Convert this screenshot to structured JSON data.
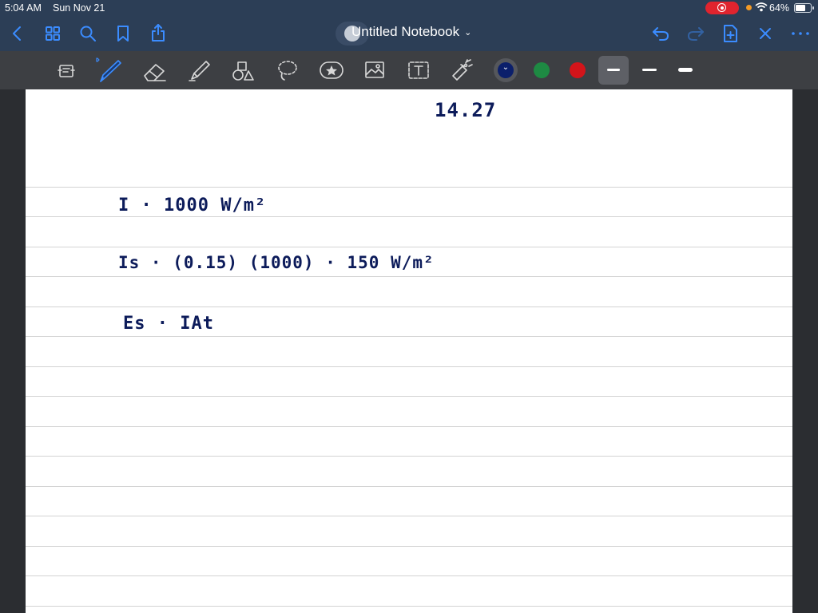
{
  "status_bar": {
    "time": "5:04 AM",
    "date": "Sun Nov 21",
    "battery": "64%",
    "battery_level": 0.64
  },
  "nav": {
    "title": "Untitled Notebook",
    "icons": [
      "back-icon",
      "thumbnails-icon",
      "search-icon",
      "bookmark-icon",
      "share-icon",
      "undo-icon",
      "redo-icon",
      "add-page-icon",
      "close-icon",
      "more-icon"
    ]
  },
  "toolbar": {
    "tools": [
      "read-only-icon",
      "pen-icon",
      "eraser-icon",
      "highlighter-icon",
      "shapes-icon",
      "lasso-icon",
      "elements-icon",
      "image-icon",
      "text-icon",
      "laser-pointer-icon"
    ],
    "colors": [
      "#0b1f6b",
      "#1e8a43",
      "#d3141a"
    ],
    "selected_color": "#0b1f6b",
    "stroke_sizes": [
      "small",
      "medium",
      "large"
    ]
  },
  "notes": {
    "problem_number": "14.27",
    "line1": "I · 1000 W/m²",
    "line2": "Is · (0.15) (1000) · 150 W/m²",
    "line3": "Es · IAt"
  },
  "accent": "#3b8cff"
}
